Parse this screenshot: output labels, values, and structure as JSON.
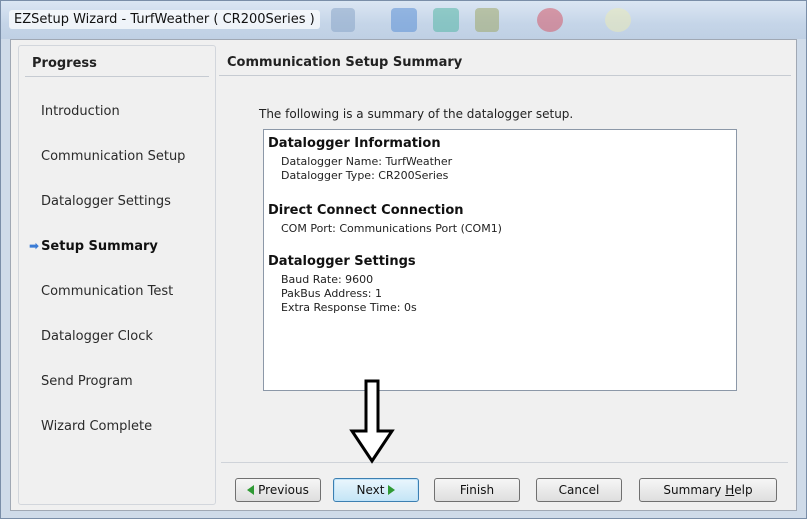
{
  "window": {
    "title": "EZSetup Wizard - TurfWeather ( CR200Series )"
  },
  "sidebar": {
    "header": "Progress",
    "steps": [
      {
        "label": "Introduction"
      },
      {
        "label": "Communication Setup"
      },
      {
        "label": "Datalogger Settings"
      },
      {
        "label": "Setup Summary",
        "current": true
      },
      {
        "label": "Communication Test"
      },
      {
        "label": "Datalogger Clock"
      },
      {
        "label": "Send Program"
      },
      {
        "label": "Wizard Complete"
      }
    ]
  },
  "main": {
    "header": "Communication Setup Summary",
    "intro": "The following is a summary of the datalogger setup.",
    "summary": {
      "sections": [
        {
          "title": "Datalogger Information",
          "lines": [
            "Datalogger Name: TurfWeather",
            "Datalogger Type: CR200Series"
          ]
        },
        {
          "title": "Direct Connect Connection",
          "lines": [
            "COM Port: Communications Port (COM1)"
          ]
        },
        {
          "title": "Datalogger Settings",
          "lines": [
            "Baud Rate: 9600",
            "PakBus Address: 1",
            "Extra Response Time: 0s"
          ]
        }
      ]
    }
  },
  "buttons": {
    "previous": "Previous",
    "next": "Next",
    "finish": "Finish",
    "cancel": "Cancel",
    "summary_prefix": "Summary ",
    "summary_hotkey": "H",
    "summary_suffix": "elp"
  },
  "colors": {
    "accent_arrow": "#3a7bd5",
    "nav_triangle": "#2f9a34",
    "window_frame": "#cfdbe9"
  },
  "icons": {
    "current_step": "arrow-right-icon",
    "previous": "green-left-triangle-icon",
    "next": "green-right-triangle-icon",
    "annotation": "large-down-arrow-icon"
  }
}
